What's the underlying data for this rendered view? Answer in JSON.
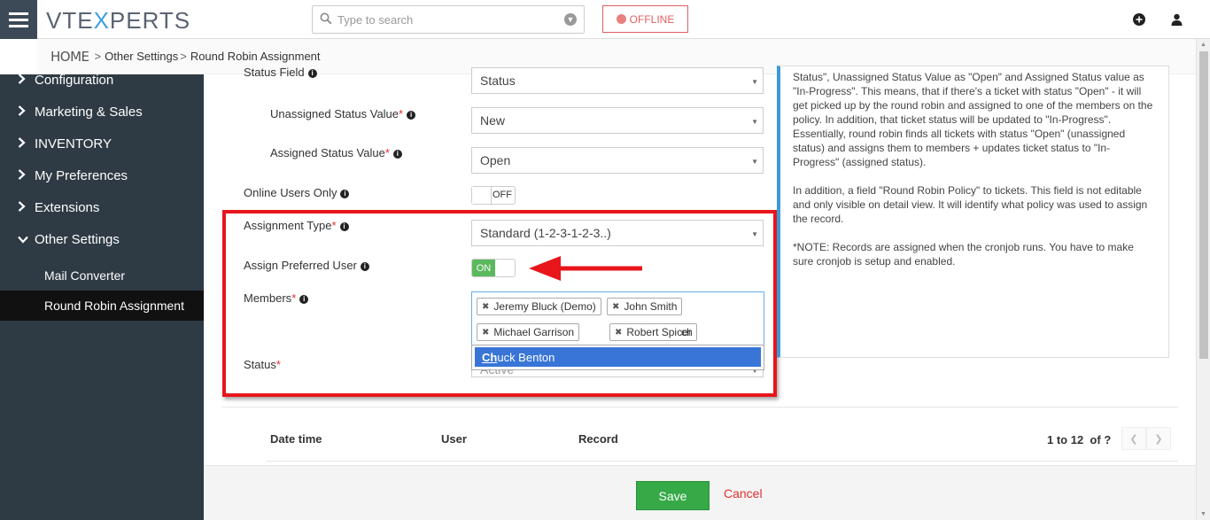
{
  "header": {
    "logo_left": "VTE",
    "logo_x": "X",
    "logo_right": "PERTS",
    "search_placeholder": "Type to search",
    "offline_label": "OFFLINE",
    "icons": [
      "menu-icon",
      "search-icon",
      "chevron-down-icon",
      "plus-circle-icon",
      "user-icon"
    ]
  },
  "breadcrumb": {
    "home": "HOME",
    "sep": ">",
    "item1": "Other Settings",
    "item2": "Round Robin Assignment"
  },
  "sidebar": {
    "items": [
      {
        "label": "Configuration",
        "icon": "chevron-right-icon"
      },
      {
        "label": "Marketing & Sales",
        "icon": "chevron-right-icon"
      },
      {
        "label": "INVENTORY",
        "icon": "chevron-right-icon"
      },
      {
        "label": "My Preferences",
        "icon": "chevron-right-icon"
      },
      {
        "label": "Extensions",
        "icon": "chevron-right-icon"
      },
      {
        "label": "Other Settings",
        "icon": "chevron-down-icon"
      }
    ],
    "subitems": [
      {
        "label": "Mail Converter",
        "active": false
      },
      {
        "label": "Round Robin Assignment",
        "active": true
      }
    ]
  },
  "form": {
    "status_field": {
      "label": "Status Field",
      "value": "Status"
    },
    "unassigned": {
      "label": "Unassigned Status Value",
      "value": "New"
    },
    "assigned": {
      "label": "Assigned Status Value",
      "value": "Open"
    },
    "online_users": {
      "label": "Online Users Only",
      "toggle": "OFF"
    },
    "assignment_type": {
      "label": "Assignment Type",
      "value": "Standard (1-2-3-1-2-3..)"
    },
    "preferred_user": {
      "label": "Assign Preferred User",
      "toggle": "ON"
    },
    "members": {
      "label": "Members",
      "tags": [
        "Jeremy Bluck (Demo)",
        "John Smith",
        "Michael Garrison",
        "Robert Spicer"
      ],
      "typed": "ch",
      "suggestion_match": "Ch",
      "suggestion_rest": "uck Benton"
    },
    "status": {
      "label": "Status",
      "value": "Active"
    },
    "required_mark": "*"
  },
  "help_panel": {
    "p1": "Status\", Unassigned Status Value as \"Open\" and Assigned Status value as \"In-Progress\". This means, that if there's a ticket with status \"Open\" - it will get picked up by the round robin and assigned to one of the members on the policy. In addition, that ticket status will be updated to \"In-Progress\". Essentially, round robin finds all tickets with status \"Open\" (unassigned status) and assigns them to members + updates ticket status to \"In-Progress\" (assigned status).",
    "p2": "In addition, a field \"Round Robin Policy\" to tickets. This field is not editable and only visible on detail view. It will identify what policy was used to assign the record.",
    "p3": "*NOTE: Records are assigned when the cronjob runs. You have to make sure cronjob is setup and enabled."
  },
  "log_table": {
    "columns": [
      "Date time",
      "User",
      "Record"
    ],
    "pager_range": "1 to 12",
    "pager_of": "of",
    "pager_total": "?"
  },
  "footer": {
    "save_label": "Save",
    "cancel_label": "Cancel"
  },
  "colors": {
    "sidebar_bg": "#2e3a44",
    "accent_red": "#e8151b",
    "save_green": "#35aa47",
    "toggle_on": "#5cb85c",
    "selection_blue": "#3875d7"
  }
}
